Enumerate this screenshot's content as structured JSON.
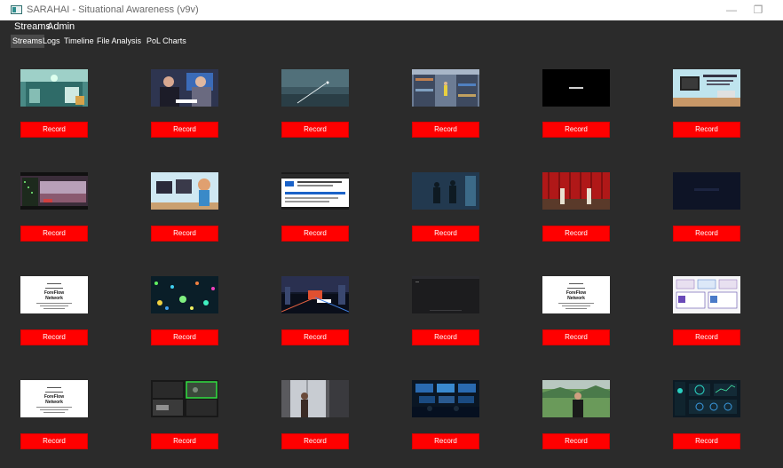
{
  "window": {
    "title": "SARAHAI - Situational Awareness (v9v)",
    "minimize_glyph": "—",
    "restore_glyph": "❐"
  },
  "menu": [
    "Streams",
    "Admin"
  ],
  "tabs": [
    {
      "label": "Streams",
      "active": true
    },
    {
      "label": "Logs",
      "active": false
    },
    {
      "label": "Timeline",
      "active": false
    },
    {
      "label": "File Analysis",
      "active": false
    },
    {
      "label": "PoL Charts",
      "active": false
    }
  ],
  "record_label": "Record",
  "colors": {
    "background": "#2b2b2b",
    "record_button": "#ff0000",
    "active_tab": "#4a4a4a"
  },
  "streams": [
    {
      "thumb": "office-atrium-cctv"
    },
    {
      "thumb": "two-men-interview"
    },
    {
      "thumb": "stormy-sky-aircraft"
    },
    {
      "thumb": "warehouse-aisle-worker"
    },
    {
      "thumb": "black-screen-caption"
    },
    {
      "thumb": "cartoon-desk-monitor"
    },
    {
      "thumb": "train-station-cityscape"
    },
    {
      "thumb": "cartoon-woman-office"
    },
    {
      "thumb": "web-page-capture"
    },
    {
      "thumb": "dark-figures-silhouette"
    },
    {
      "thumb": "red-curtain-stage"
    },
    {
      "thumb": "dark-navy-screen"
    },
    {
      "thumb": "white-title-card",
      "lines": [
        "ForeFlow",
        "Network"
      ]
    },
    {
      "thumb": "bokeh-network-lights"
    },
    {
      "thumb": "futuristic-city-neon"
    },
    {
      "thumb": "dark-console-screen"
    },
    {
      "thumb": "white-title-card",
      "lines": [
        "ForeFlow",
        "Network"
      ]
    },
    {
      "thumb": "process-diagram-slide"
    },
    {
      "thumb": "white-title-card",
      "lines": [
        "ForeFlow",
        "Network"
      ]
    },
    {
      "thumb": "cctv-multi-grid"
    },
    {
      "thumb": "person-at-window"
    },
    {
      "thumb": "control-room-screens"
    },
    {
      "thumb": "man-green-valley"
    },
    {
      "thumb": "dashboard-dark-ui"
    }
  ]
}
